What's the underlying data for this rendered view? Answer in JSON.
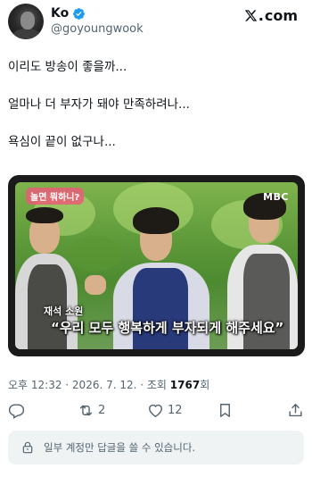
{
  "user": {
    "display_name": "Ko",
    "handle": "@goyoungwook",
    "verified": true
  },
  "brand": {
    "logo_text": "com",
    "site": "X.com"
  },
  "tweet": {
    "lines": [
      "이리도 방송이 좋을까...",
      "얼마나 더 부자가 돼야 만족하려나...",
      "욕심이 끝이 없구나..."
    ]
  },
  "media": {
    "show_logo": "놀면 뭐하니?",
    "broadcaster": "MBC",
    "speaker_caption": "재석 소원",
    "subtitle": "“우리 모두 행복하게 부자되게 해주세요”"
  },
  "meta": {
    "prefix": "오후 12:32 · 2026. 7. 12. · 조회",
    "views": "1767",
    "suffix": "회"
  },
  "actions": {
    "retweets": "2",
    "likes": "12"
  },
  "reply": {
    "notice": "일부 계정만 답글을 쓸 수 있습니다."
  },
  "colors": {
    "verified_blue": "#1d9bf0",
    "secondary_text": "#536471",
    "primary_text": "#0f1419",
    "reply_bg": "#eff3f4"
  }
}
